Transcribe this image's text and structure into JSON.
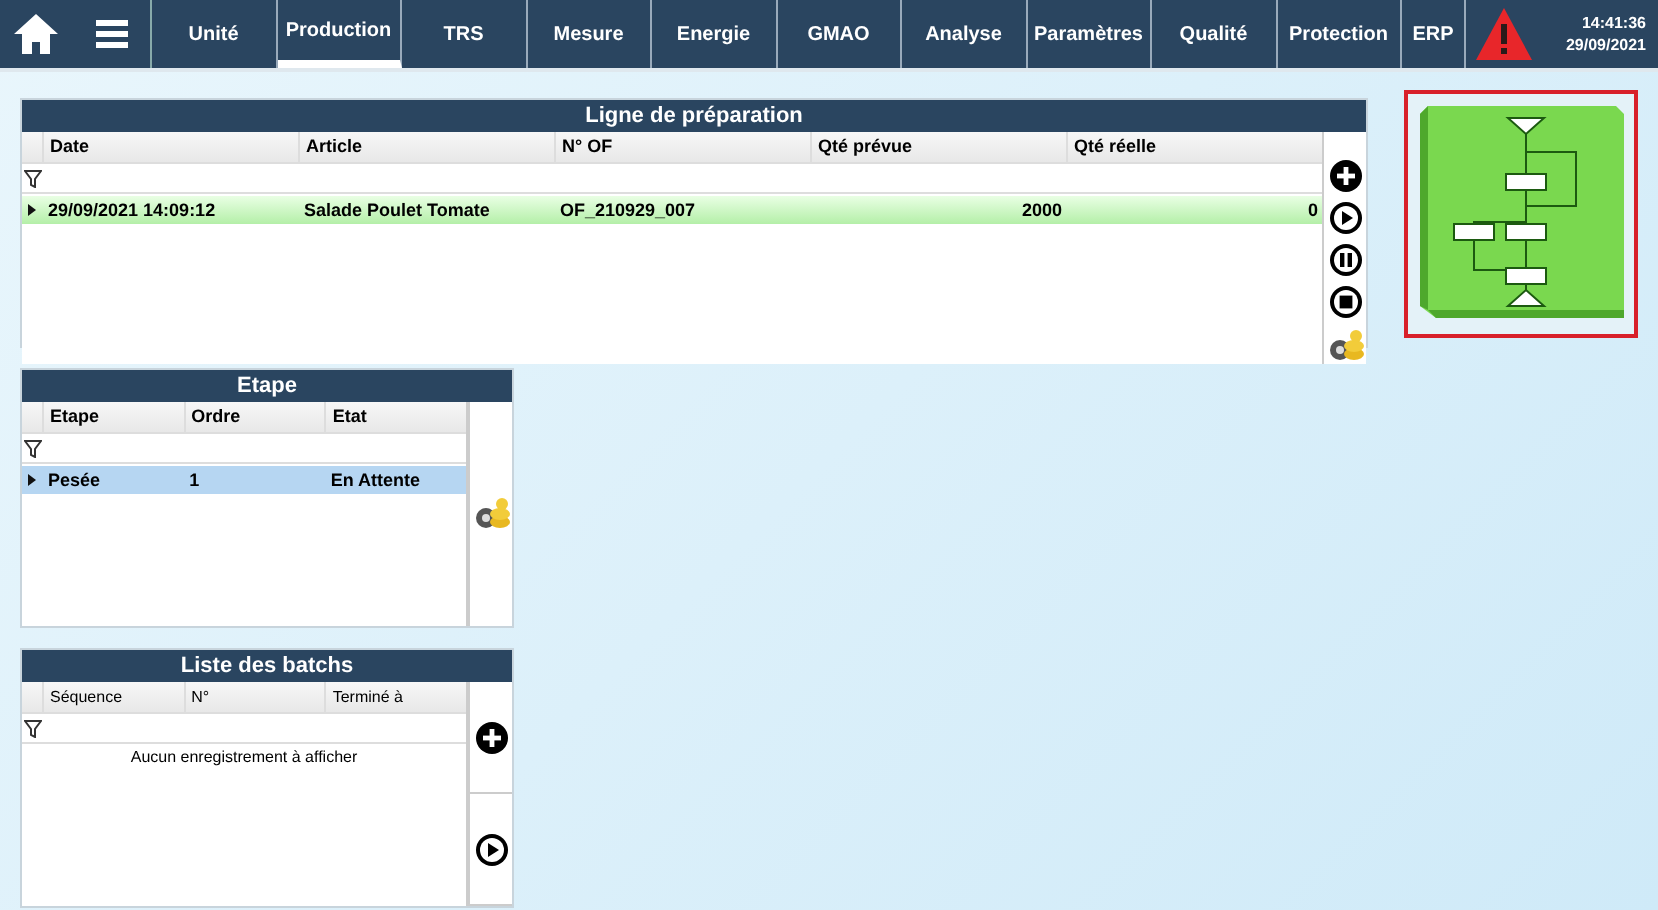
{
  "nav": {
    "tabs": [
      {
        "label": "Unité",
        "selected": false
      },
      {
        "label": "Production",
        "selected": true
      },
      {
        "label": "TRS",
        "selected": false
      },
      {
        "label": "Mesure",
        "selected": false
      },
      {
        "label": "Energie",
        "selected": false
      },
      {
        "label": "GMAO",
        "selected": false
      },
      {
        "label": "Analyse",
        "selected": false
      },
      {
        "label": "Paramètres",
        "selected": false
      },
      {
        "label": "Qualité",
        "selected": false
      },
      {
        "label": "Protection",
        "selected": false
      },
      {
        "label": "ERP",
        "selected": false
      }
    ],
    "time": "14:41:36",
    "date": "29/09/2021"
  },
  "preparation": {
    "title": "Ligne de préparation",
    "columns": [
      "Date",
      "Article",
      "N° OF",
      "Qté prévue",
      "Qté réelle"
    ],
    "rows": [
      {
        "cells": [
          "29/09/2021 14:09:12",
          "Salade Poulet Tomate",
          "OF_210929_007",
          "2000",
          "0"
        ],
        "selected": true
      }
    ]
  },
  "etape": {
    "title": "Etape",
    "columns": [
      "Etape",
      "Ordre",
      "Etat"
    ],
    "rows": [
      {
        "cells": [
          "Pesée",
          "1",
          "En Attente"
        ],
        "selected": true
      }
    ]
  },
  "batchs": {
    "title": "Liste des batchs",
    "columns": [
      "Séquence",
      "N°",
      "Terminé à"
    ],
    "empty": "Aucun enregistrement à afficher"
  }
}
